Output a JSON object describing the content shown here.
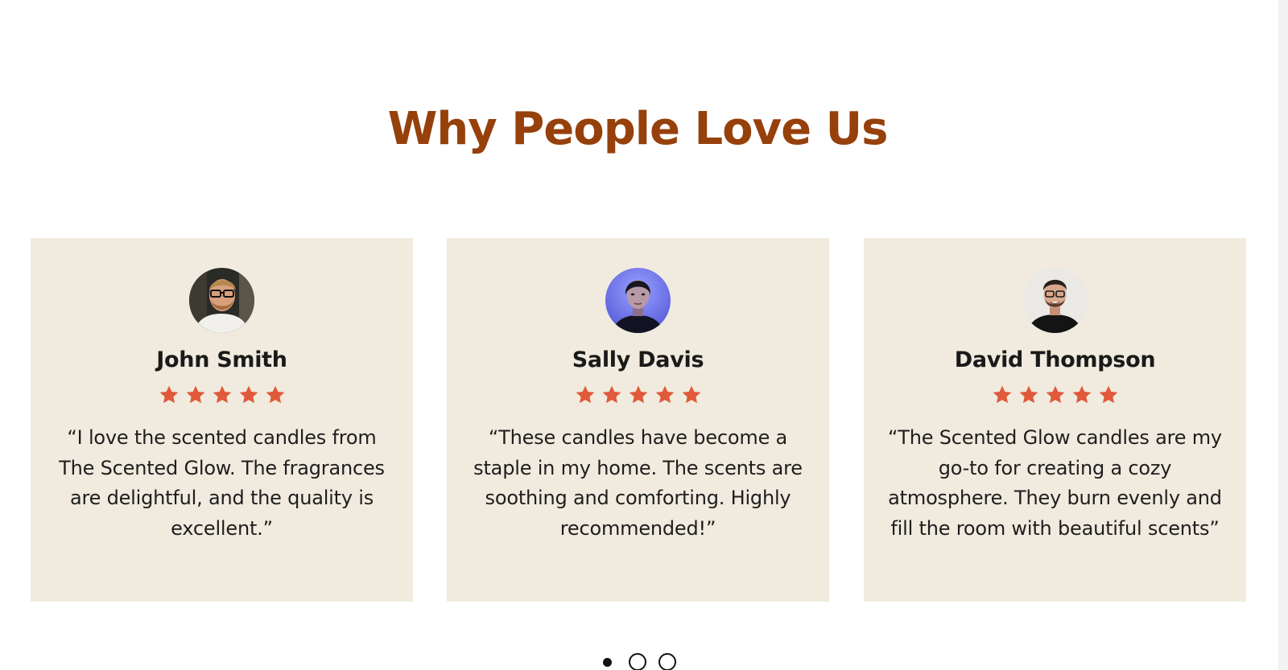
{
  "section": {
    "title": "Why People Love Us"
  },
  "testimonials": [
    {
      "name": "John Smith",
      "rating": 5,
      "rating_max": 5,
      "text": "“I love the scented candles from The Scented Glow. The fragrances are delightful, and the quality is excellent.”",
      "avatar": "man-with-glasses-photo"
    },
    {
      "name": "Sally Davis",
      "rating": 5,
      "rating_max": 5,
      "text": "“These candles have become a staple in my home. The scents are soothing and comforting. Highly recommended!”",
      "avatar": "woman-blue-light-photo"
    },
    {
      "name": "David Thompson",
      "rating": 5,
      "rating_max": 5,
      "text": "“The Scented Glow candles are my go-to for creating a cozy atmosphere. They burn evenly and fill the room with beautiful scents”",
      "avatar": "smiling-man-photo"
    }
  ],
  "carousel": {
    "current_page": 1,
    "total_pages": 3
  },
  "colors": {
    "title": "#96400b",
    "card_background": "#f0ebde",
    "star": "#e0593a",
    "text": "#1e1e1e"
  }
}
